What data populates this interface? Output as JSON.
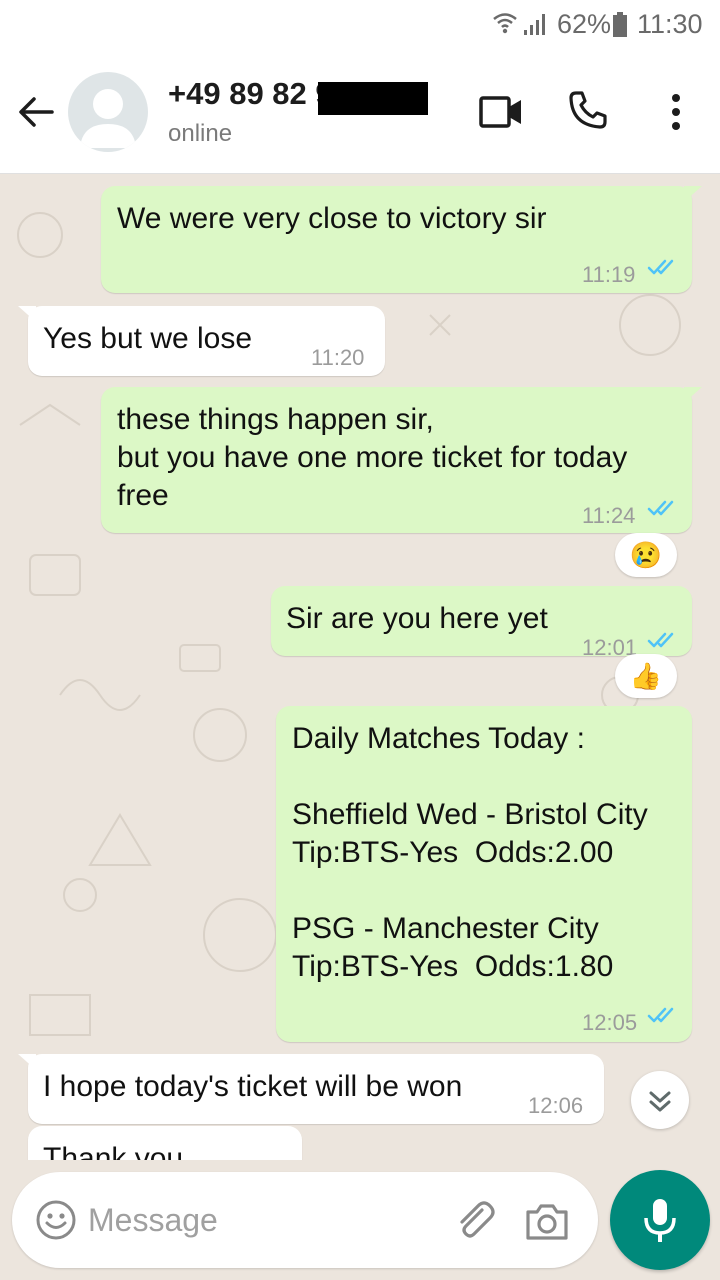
{
  "status_bar": {
    "battery_percent": "62%",
    "time": "11:30"
  },
  "header": {
    "contact_name": "+49 89 82        9",
    "contact_status": "online"
  },
  "messages": [
    {
      "direction": "out",
      "text": "We were very close to victory sir",
      "time": "11:19",
      "read": true
    },
    {
      "direction": "in",
      "text": "Yes but we lose",
      "time": "11:20"
    },
    {
      "direction": "out",
      "text": "these things happen sir,\nbut you have one more ticket for today\nfree",
      "time": "11:24",
      "read": true,
      "reaction": "😢"
    },
    {
      "direction": "out",
      "text": "Sir are you here yet",
      "time": "12:01",
      "read": true,
      "reaction": "👍"
    },
    {
      "direction": "out",
      "text": "Daily Matches Today :\n\nSheffield Wed - Bristol City\nTip:BTS-Yes  Odds:2.00\n\nPSG - Manchester City\nTip:BTS-Yes  Odds:1.80",
      "time": "12:05",
      "read": true
    },
    {
      "direction": "in",
      "text": "I hope today's ticket will be won",
      "time": "12:06"
    },
    {
      "direction": "in",
      "text": "Thank you",
      "time": ""
    }
  ],
  "input": {
    "placeholder": "Message"
  },
  "colors": {
    "outgoing_bubble": "#dcf8c6",
    "incoming_bubble": "#ffffff",
    "chat_background": "#ece5dd",
    "read_ticks": "#4fc3f7",
    "mic_button": "#00897b"
  },
  "icons": [
    "back-arrow-icon",
    "avatar-placeholder-icon",
    "video-call-icon",
    "phone-icon",
    "more-vert-icon",
    "emoji-icon",
    "attach-icon",
    "camera-icon",
    "mic-icon",
    "double-chevron-down-icon",
    "double-check-icon"
  ]
}
